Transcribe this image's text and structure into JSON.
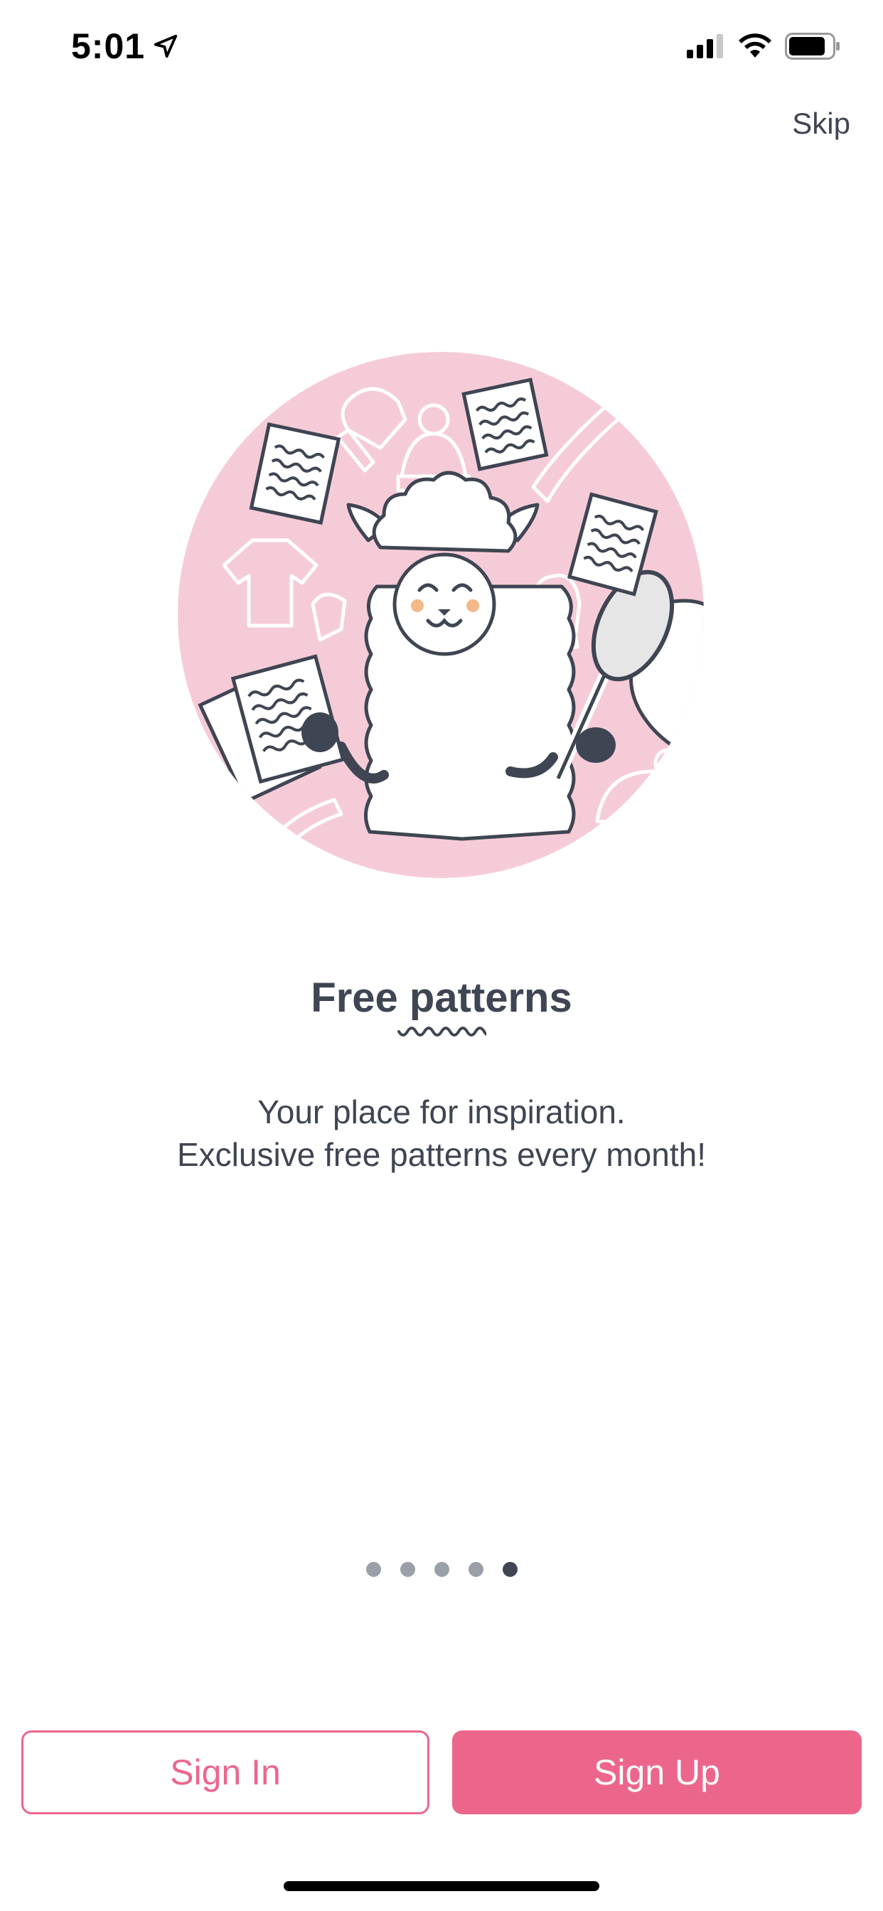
{
  "status_bar": {
    "time": "5:01",
    "location_icon": "location-arrow-icon",
    "signal_icon": "cellular-signal-icon",
    "wifi_icon": "wifi-icon",
    "battery_icon": "battery-icon"
  },
  "header": {
    "skip_label": "Skip"
  },
  "onboarding": {
    "illustration": "llama-with-patterns-illustration",
    "title": "Free patterns",
    "description_line1": "Your place for inspiration.",
    "description_line2": "Exclusive free patterns every month!",
    "page_count": 5,
    "current_page": 5
  },
  "actions": {
    "sign_in_label": "Sign In",
    "sign_up_label": "Sign Up"
  },
  "colors": {
    "accent": "#ec668c",
    "illustration_bg": "#f6cbd8",
    "text": "#3f4552",
    "dot_inactive": "#9a9fa8"
  }
}
